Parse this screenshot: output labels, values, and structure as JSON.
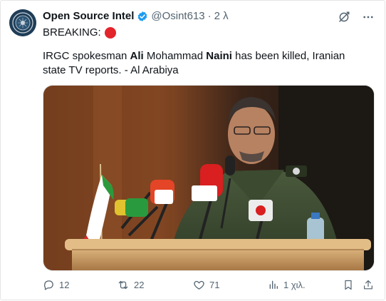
{
  "author": {
    "name": "Open Source Intel",
    "handle": "@Osint613",
    "separator": "·",
    "time": "2 λ"
  },
  "tweet": {
    "line1": "BREAKING:",
    "body_before_1": "IRGC spokesman ",
    "bold_1": "Ali",
    "body_between": " Mohammad ",
    "bold_2": "Naini",
    "body_after": " has been killed, Iranian state TV reports. - Al Arabiya"
  },
  "actions": {
    "replies": "12",
    "reposts": "22",
    "likes": "71",
    "views": "1 χιλ."
  },
  "icons": {
    "verified": "verified-badge-icon",
    "grok": "grok-icon",
    "more": "more-icon",
    "reply": "reply-icon",
    "repost": "repost-icon",
    "like": "heart-icon",
    "views": "views-icon",
    "bookmark": "bookmark-icon",
    "share": "share-icon"
  },
  "colors": {
    "verified_blue": "#1d9bf0",
    "muted_text": "#536471",
    "breaking_dot": "#e3242b"
  }
}
